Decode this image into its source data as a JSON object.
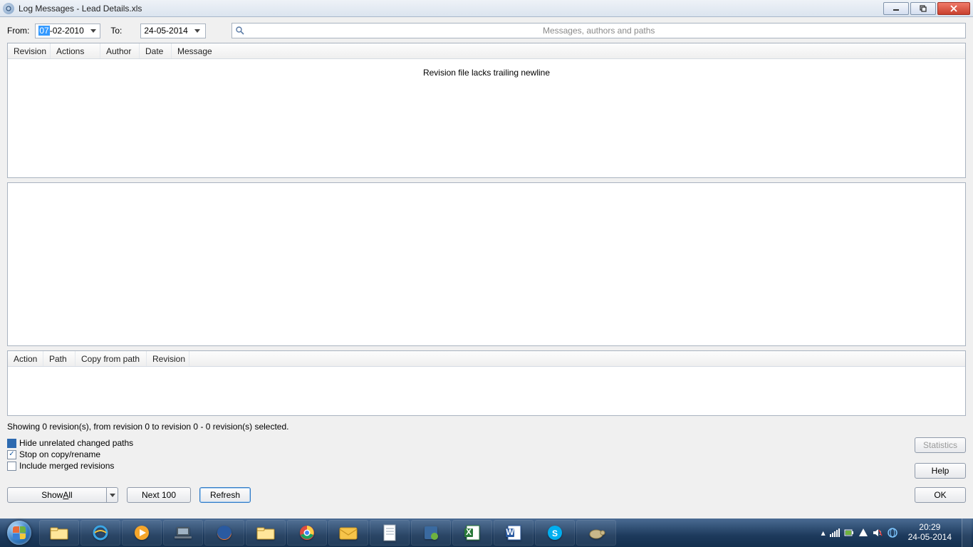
{
  "titlebar": {
    "title": "Log Messages - Lead Details.xls"
  },
  "filters": {
    "from_label": "From:",
    "to_label": "To:",
    "from_sel": "07",
    "from_rest": "-02-2010",
    "to_date": "24-05-2014",
    "search_placeholder": "Messages, authors and paths"
  },
  "columns_top": {
    "c1": "Revision",
    "c2": "Actions",
    "c3": "Author",
    "c4": "Date",
    "c5": "Message"
  },
  "message": "Revision file lacks trailing newline",
  "columns_bottom": {
    "c1": "Action",
    "c2": "Path",
    "c3": "Copy from path",
    "c4": "Revision"
  },
  "status": "Showing 0 revision(s), from revision 0 to revision 0 - 0 revision(s) selected.",
  "opts": {
    "hide": "Hide unrelated changed paths",
    "stop": "Stop on copy/rename",
    "merged": "Include merged revisions"
  },
  "buttons": {
    "statistics": "Statistics",
    "help": "Help",
    "ok": "OK",
    "show_all_pre": "Show ",
    "show_all_u": "A",
    "show_all_post": "ll",
    "next100": "Next 100",
    "refresh": "Refresh"
  },
  "taskbar": {
    "time": "20:29",
    "date": "24-05-2014"
  }
}
